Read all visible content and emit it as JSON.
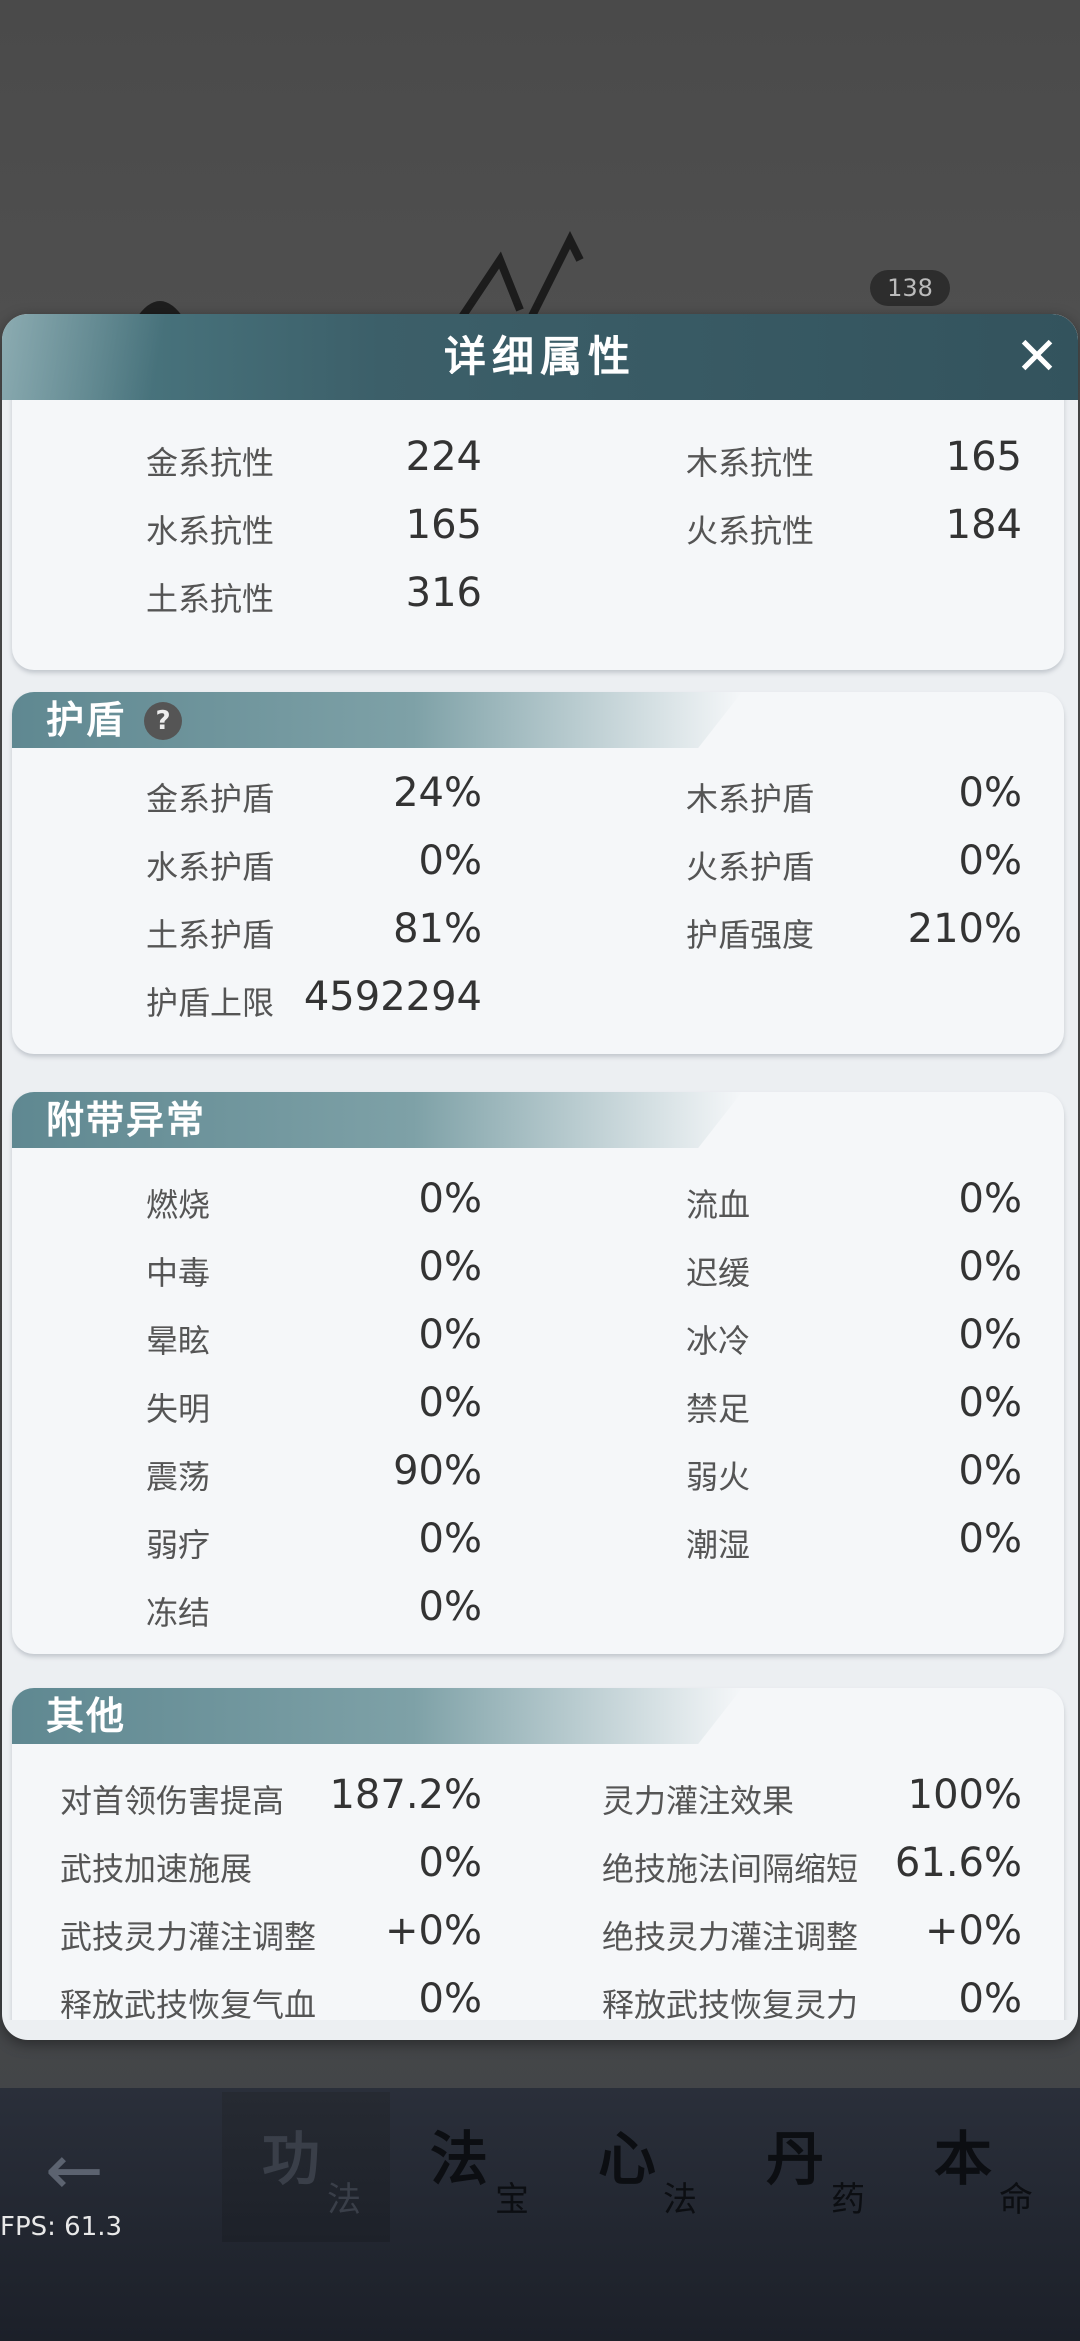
{
  "background": {
    "badge": "138"
  },
  "modal": {
    "title": "详细属性",
    "close": "✕"
  },
  "resistance": {
    "items": [
      {
        "label": "金系抗性",
        "value": "224"
      },
      {
        "label": "木系抗性",
        "value": "165"
      },
      {
        "label": "水系抗性",
        "value": "165"
      },
      {
        "label": "火系抗性",
        "value": "184"
      },
      {
        "label": "土系抗性",
        "value": "316"
      }
    ]
  },
  "shield": {
    "title": "护盾",
    "help": "?",
    "items": [
      {
        "label": "金系护盾",
        "value": "24%"
      },
      {
        "label": "木系护盾",
        "value": "0%"
      },
      {
        "label": "水系护盾",
        "value": "0%"
      },
      {
        "label": "火系护盾",
        "value": "0%"
      },
      {
        "label": "土系护盾",
        "value": "81%"
      },
      {
        "label": "护盾强度",
        "value": "210%"
      },
      {
        "label": "护盾上限",
        "value": "4592294"
      }
    ]
  },
  "abnormal": {
    "title": "附带异常",
    "items": [
      {
        "label": "燃烧",
        "value": "0%"
      },
      {
        "label": "流血",
        "value": "0%"
      },
      {
        "label": "中毒",
        "value": "0%"
      },
      {
        "label": "迟缓",
        "value": "0%"
      },
      {
        "label": "晕眩",
        "value": "0%"
      },
      {
        "label": "冰冷",
        "value": "0%"
      },
      {
        "label": "失明",
        "value": "0%"
      },
      {
        "label": "禁足",
        "value": "0%"
      },
      {
        "label": "震荡",
        "value": "90%"
      },
      {
        "label": "弱火",
        "value": "0%"
      },
      {
        "label": "弱疗",
        "value": "0%"
      },
      {
        "label": "潮湿",
        "value": "0%"
      },
      {
        "label": "冻结",
        "value": "0%"
      }
    ]
  },
  "other": {
    "title": "其他",
    "items": [
      {
        "label": "对首领伤害提高",
        "value": "187.2%"
      },
      {
        "label": "灵力灌注效果",
        "value": "100%"
      },
      {
        "label": "武技加速施展",
        "value": "0%"
      },
      {
        "label": "绝技施法间隔缩短",
        "value": "61.6%"
      },
      {
        "label": "武技灵力灌注调整",
        "value": "+0%"
      },
      {
        "label": "绝技灵力灌注调整",
        "value": "+0%"
      },
      {
        "label": "释放武技恢复气血",
        "value": "0%"
      },
      {
        "label": "释放武技恢复灵力",
        "value": "0%"
      }
    ]
  },
  "bottom_nav": {
    "back": "←",
    "tabs": [
      {
        "big": "功",
        "small": "法"
      },
      {
        "big": "法",
        "small": "宝"
      },
      {
        "big": "心",
        "small": "法"
      },
      {
        "big": "丹",
        "small": "药"
      },
      {
        "big": "本",
        "small": "命"
      }
    ]
  },
  "fps": "FPS: 61.3"
}
